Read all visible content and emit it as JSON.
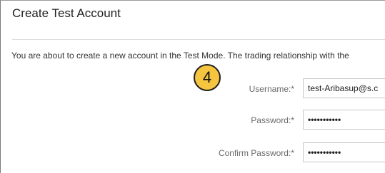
{
  "dialog": {
    "title": "Create Test Account",
    "intro": "You are about to create a new account in the Test Mode. The trading relationship with the"
  },
  "step_badge": "4",
  "form": {
    "required_marker": "*",
    "username": {
      "label": "Username:",
      "value": "test-Aribasup@s.c"
    },
    "password": {
      "label": "Password:",
      "value": "•••••••••••"
    },
    "confirm_password": {
      "label": "Confirm Password:",
      "value": "•••••••••••"
    }
  },
  "colors": {
    "badge_fill": "#f5c540",
    "badge_border": "#1f1f1f"
  }
}
